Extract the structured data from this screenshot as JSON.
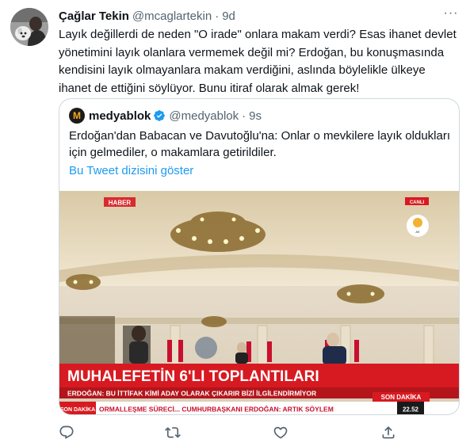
{
  "tweet": {
    "name": "Çağlar Tekin",
    "handle": "@mcaglartekin",
    "separator": "·",
    "time": "9d",
    "more": "···",
    "text": "Layık değillerdi de neden \"O irade\" onlara makam verdi? Esas ihanet devlet yönetimini layık olanlara vermemek değil mi? Erdoğan, bu konuşmasında kendisini layık olmayanlara makam verdiğini, aslında böylelikle ülkeye ihanet de ettiğini söylüyor. Bunu itiraf olarak almak gerek!"
  },
  "quote": {
    "logo_letter": "M",
    "name": "medyablok",
    "handle": "@medyablok",
    "separator": "·",
    "time": "9s",
    "text": "Erdoğan'dan Babacan ve Davutoğlu'na: Onlar o mevkilere layık oldukları için gelmediler, o makamlara getirildiler.",
    "thread_link": "Bu Tweet dizisini göster"
  },
  "media": {
    "channel_badge": "HABER",
    "live_badge": "CANLI",
    "headline": "MUHALEFETİN 6'LI TOPLANTILARI",
    "subheadline": "ERDOĞAN: BU İTTİFAK KİMİ ADAY OLARAK ÇIKARIR BİZİ İLGİLENDİRMİYOR",
    "breaking_tag": "SON DAKİKA",
    "ticker_tag": "SON DAKİKA",
    "ticker_text": "ORMALLEŞME SÜRECİ... CUMHURBAŞKANI ERDOĞAN: ARTIK SÖYLEM",
    "clock": "22.52"
  },
  "colors": {
    "text": "#0f1419",
    "secondary": "#536471",
    "link": "#1d9bf0",
    "border": "#cfd9de",
    "news_red": "#d71a21"
  }
}
